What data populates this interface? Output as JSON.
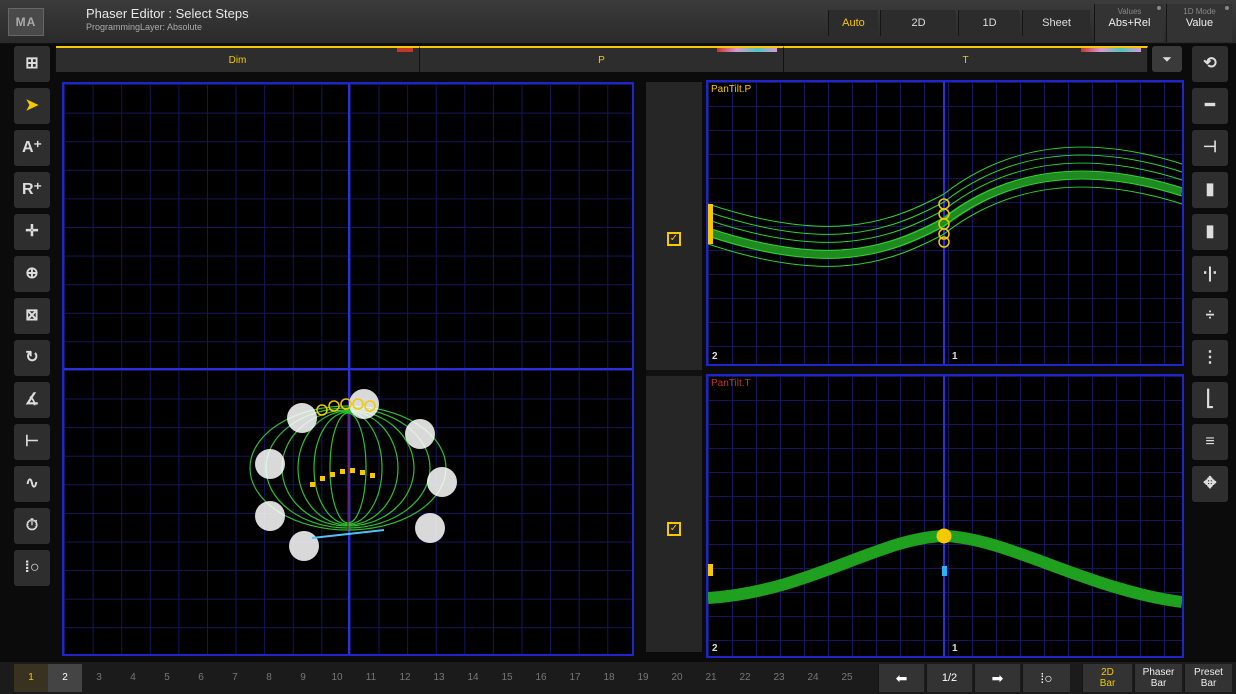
{
  "window": {
    "logo": "MA",
    "title": "Phaser Editor : Select Steps",
    "subtitle": "ProgrammingLayer: Absolute"
  },
  "header_buttons": {
    "auto": "Auto",
    "two_d": "2D",
    "one_d": "1D",
    "sheet": "Sheet",
    "values_label": "Values",
    "values_value": "Abs+Rel",
    "mode_label": "1D Mode",
    "mode_value": "Value"
  },
  "tabs": [
    {
      "label": "Dim",
      "color": "#c0392b"
    },
    {
      "label": "P",
      "color": "#c7a0d8"
    },
    {
      "label": "T",
      "color": "#c7a0d8"
    }
  ],
  "left_tools": [
    {
      "icon": "add-window-icon",
      "glyph": "⊞"
    },
    {
      "icon": "select-arrow-icon",
      "glyph": "➤"
    },
    {
      "icon": "add-absolute-icon",
      "glyph": "A⁺"
    },
    {
      "icon": "add-relative-icon",
      "glyph": "R⁺"
    },
    {
      "icon": "move-icon",
      "glyph": "✛"
    },
    {
      "icon": "crosshair-icon",
      "glyph": "⊕"
    },
    {
      "icon": "grid-select-icon",
      "glyph": "⊠"
    },
    {
      "icon": "rotate-icon",
      "glyph": "↻"
    },
    {
      "icon": "angle-icon",
      "glyph": "∡"
    },
    {
      "icon": "width-icon",
      "glyph": "⊢"
    },
    {
      "icon": "transition-icon",
      "glyph": "∿"
    },
    {
      "icon": "timer-icon",
      "glyph": "⏱"
    },
    {
      "icon": "step-settings-icon",
      "glyph": "⁞○"
    }
  ],
  "right_tools": [
    {
      "icon": "reset-icon",
      "glyph": "⟲"
    },
    {
      "icon": "minus-icon",
      "glyph": "━"
    },
    {
      "icon": "align-left-icon",
      "glyph": "⊣"
    },
    {
      "icon": "import-icon",
      "glyph": "▮"
    },
    {
      "icon": "export-icon",
      "glyph": "▮"
    },
    {
      "icon": "split-icon",
      "glyph": "⋅|⋅"
    },
    {
      "icon": "divide-icon",
      "glyph": "÷"
    },
    {
      "icon": "spread-icon",
      "glyph": "⋮"
    },
    {
      "icon": "phase-icon",
      "glyph": "⎣"
    },
    {
      "icon": "stack-icon",
      "glyph": "≡"
    },
    {
      "icon": "center-icon",
      "glyph": "✥"
    }
  ],
  "graphs": {
    "pan_title": "PanTilt.P",
    "tilt_title": "PanTilt.T",
    "label_left": "2",
    "label_mid": "1"
  },
  "checkbox_glyph": "✓",
  "steps": [
    "1",
    "2",
    "3",
    "4",
    "5",
    "6",
    "7",
    "8",
    "9",
    "10",
    "11",
    "12",
    "13",
    "14",
    "15",
    "16",
    "17",
    "18",
    "19",
    "20",
    "21",
    "22",
    "23",
    "24",
    "25",
    "2"
  ],
  "nav": {
    "prev": "⬅",
    "page": "1/2",
    "next": "➡",
    "settings": "⁞○"
  },
  "bars": [
    {
      "line1": "2D",
      "line2": "Bar"
    },
    {
      "line1": "Phaser",
      "line2": "Bar"
    },
    {
      "line1": "Preset",
      "line2": "Bar"
    }
  ]
}
